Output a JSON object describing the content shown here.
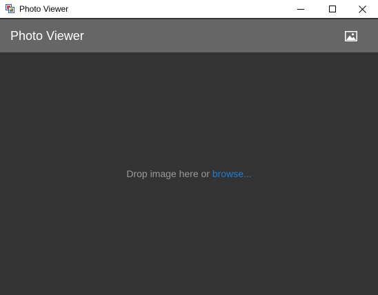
{
  "window": {
    "title": "Photo Viewer",
    "controls": {
      "minimize_icon": "minimize-icon",
      "maximize_icon": "maximize-icon",
      "close_icon": "close-icon"
    }
  },
  "header": {
    "title": "Photo Viewer",
    "open_image_icon": "image-icon"
  },
  "content": {
    "drop_text": "Drop image here or ",
    "browse_label": "browse..."
  },
  "colors": {
    "titlebar_bg": "#ffffff",
    "header_bg": "#666666",
    "content_bg": "#333333",
    "hint_text": "#9a9a9a",
    "link": "#1e7fd6"
  }
}
